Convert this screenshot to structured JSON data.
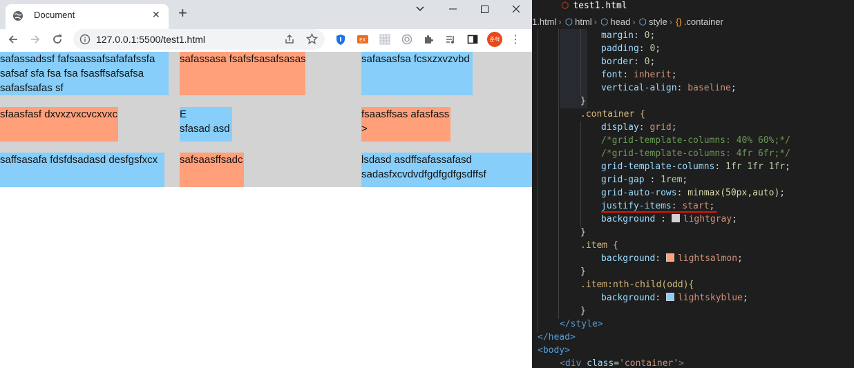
{
  "browser": {
    "tab_title": "Document",
    "tab_close": "✕",
    "new_tab": "+",
    "url": "127.0.0.1:5500/test1.html",
    "profile_text": "준혁",
    "window": {
      "chevron": "⌄",
      "min": "—",
      "max": "☐",
      "close": "✕"
    }
  },
  "page": {
    "grid_background": "#d3d3d3",
    "odd_color": "#87cefa",
    "even_color": "#ffa07a",
    "items": [
      {
        "lines": [
          "safassadssf fafsaassafsafafafssfa",
          "safsaf sfa fsa fsa fsasffsafsafsa",
          "safasfsafas sf"
        ]
      },
      {
        "lines": [
          "safassasa fsafsfsasafsasas"
        ]
      },
      {
        "lines": [
          "safasasfsa fcsxzxvzvbd"
        ]
      },
      {
        "lines": [
          "sfaasfasf dxvxzvxcvcxvxc"
        ]
      },
      {
        "lines": [
          "E",
          "sfasad asd"
        ]
      },
      {
        "lines": [
          "fsaasffsas afasfass",
          ">"
        ]
      },
      {
        "lines": [
          "saffsasafa fdsfdsadasd desfgsfxcx"
        ]
      },
      {
        "lines": [
          "safsaasffsadc"
        ]
      },
      {
        "lines": [
          "lsdasd asdffsafassafasd",
          "sadasfxcvdvdfgdfgdfgsdffsf"
        ]
      }
    ]
  },
  "editor": {
    "tab_filename": "test1.html",
    "breadcrumbs": [
      "1.html",
      "html",
      "head",
      "style",
      ".container"
    ],
    "code": {
      "l1": {
        "prop": "margin",
        "val": "0"
      },
      "l2": {
        "prop": "padding",
        "val": "0"
      },
      "l3": {
        "prop": "border",
        "val": "0"
      },
      "l4": {
        "prop": "font",
        "val": "inherit"
      },
      "l5": {
        "prop": "vertical-align",
        "val": "baseline"
      },
      "l6": "}",
      "l7": ".container {",
      "l8": {
        "prop": "display",
        "val": "grid"
      },
      "l9": "/*grid-template-columns: 40% 60%;*/",
      "l10": "/*grid-template-columns: 4fr 6fr;*/",
      "l11": {
        "prop": "grid-template-columns",
        "val": "1fr 1fr 1fr"
      },
      "l12": {
        "prop": "grid-gap ",
        "val": "1rem"
      },
      "l13": {
        "prop": "grid-auto-rows",
        "val": "minmax(50px,auto)"
      },
      "l14": {
        "prop": "justify-items",
        "val": "start"
      },
      "l15": {
        "prop": "background ",
        "val": "lightgray",
        "swatch": "#d3d3d3"
      },
      "l16": "}",
      "l17": ".item {",
      "l18": {
        "prop": "background",
        "val": "lightsalmon",
        "swatch": "#ffa07a"
      },
      "l19": "}",
      "l20": ".item:nth-child(odd){",
      "l21": {
        "prop": "background",
        "val": "lightskyblue",
        "swatch": "#87cefa"
      },
      "l22": "}",
      "l23": "</style>",
      "l24": "</head>",
      "l25": "<body>",
      "l26": {
        "tag": "div",
        "attr": "class",
        "val": "'container'"
      }
    }
  }
}
